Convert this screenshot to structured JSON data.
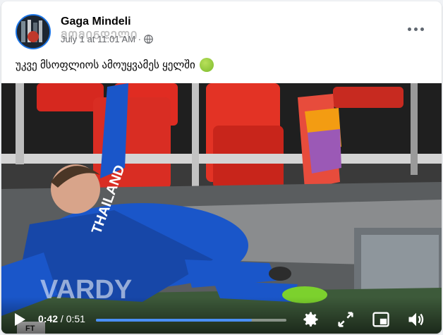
{
  "post": {
    "author": "Gaga Mindeli",
    "meta_time": "July 1 at 11:01 AM · ",
    "meta_overlay": "ᲛᲝᲛᲘᲜᲓᲔᲚᲘ",
    "caption": "უკვე მსოფლიოს ამოუყვამეს ყელში"
  },
  "video": {
    "current_time": "0:42",
    "duration": "/ 0:51",
    "progress_fraction": 0.82,
    "jersey_name": "VARDY",
    "sponsor": "THAILAND",
    "corner_label": "FT"
  },
  "colors": {
    "accent": "#1b74e4",
    "progress": "#4a8ff5",
    "jersey": "#1a56c9"
  }
}
